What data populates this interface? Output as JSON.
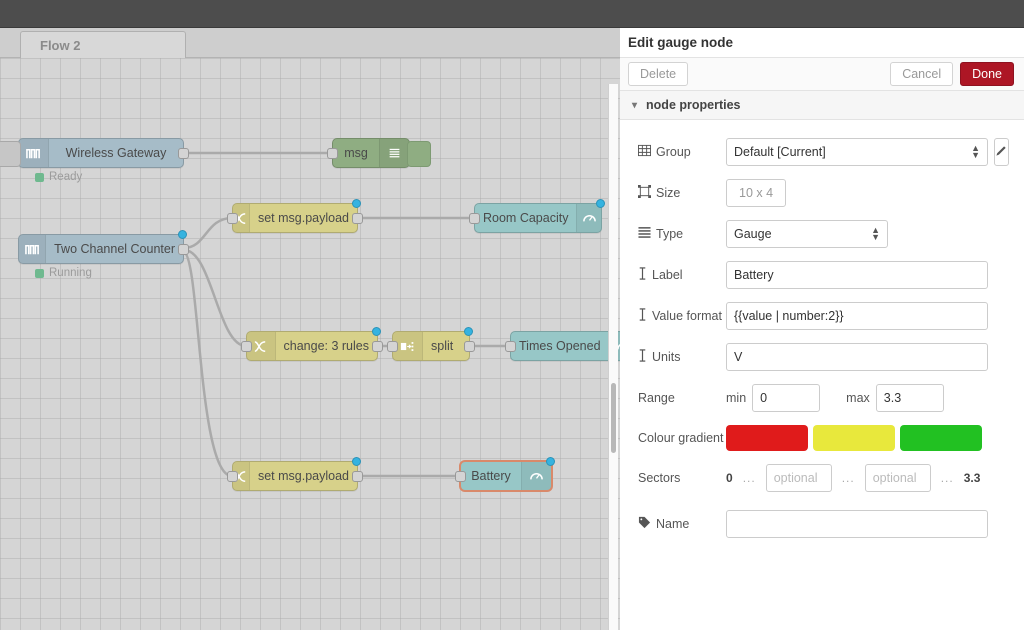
{
  "window": {
    "topbar_title": ""
  },
  "editor": {
    "tab": {
      "label": "Flow 2"
    },
    "nodes": [
      {
        "id": "wireless-gateway",
        "label": "Wireless Gateway",
        "status": "Ready",
        "type": "link",
        "color": "blue",
        "icon": "pulse-icon",
        "dirty": false,
        "selected": false
      },
      {
        "id": "two-channel-counter",
        "label": "Two Channel Counter",
        "status": "Running",
        "type": "link",
        "color": "blue",
        "icon": "pulse-icon",
        "dirty": true,
        "selected": false
      },
      {
        "id": "msg-debug",
        "label": "msg",
        "status": "",
        "type": "debug",
        "color": "green",
        "icon": "debug-lines-icon",
        "dirty": false,
        "selected": false
      },
      {
        "id": "set-msg-payload-1",
        "label": "set msg.payload",
        "status": "",
        "type": "change",
        "color": "yellow",
        "icon": "change-icon",
        "dirty": true,
        "selected": false
      },
      {
        "id": "room-capacity",
        "label": "Room Capacity",
        "status": "",
        "type": "gauge",
        "color": "teal",
        "icon": "gauge-icon",
        "dirty": true,
        "selected": false
      },
      {
        "id": "change-3-rules",
        "label": "change: 3 rules",
        "status": "",
        "type": "change",
        "color": "yellow",
        "icon": "change-icon",
        "dirty": true,
        "selected": false
      },
      {
        "id": "split",
        "label": "split",
        "status": "",
        "type": "split",
        "color": "yellow",
        "icon": "split-icon",
        "dirty": true,
        "selected": false
      },
      {
        "id": "times-opened",
        "label": "Times Opened",
        "status": "",
        "type": "gauge",
        "color": "teal",
        "icon": "gauge-icon",
        "dirty": false,
        "selected": false
      },
      {
        "id": "set-msg-payload-2",
        "label": "set msg.payload",
        "status": "",
        "type": "change",
        "color": "yellow",
        "icon": "change-icon",
        "dirty": true,
        "selected": false
      },
      {
        "id": "battery",
        "label": "Battery",
        "status": "",
        "type": "gauge",
        "color": "teal",
        "icon": "gauge-icon",
        "dirty": true,
        "selected": true
      }
    ]
  },
  "panel": {
    "title": "Edit gauge node",
    "actions": {
      "delete_label": "Delete",
      "cancel_label": "Cancel",
      "done_label": "Done",
      "done_color": "#ad1625"
    },
    "section": {
      "label": "node properties",
      "chevron": "⌄"
    },
    "fields": {
      "group": {
        "label": "Group",
        "icon": "table-icon",
        "value": "Default [Current]",
        "edit_button": "pencil-icon"
      },
      "size": {
        "label": "Size",
        "icon": "resize-icon",
        "value": "10 x 4"
      },
      "type": {
        "label": "Type",
        "icon": "list-icon",
        "value": "Gauge"
      },
      "label": {
        "label": "Label",
        "icon": "text-cursor-icon",
        "value": "Battery",
        "placeholder": ""
      },
      "value_format": {
        "label": "Value format",
        "icon": "text-cursor-icon",
        "value": "{{value | number:2}}",
        "placeholder": ""
      },
      "units": {
        "label": "Units",
        "icon": "text-cursor-icon",
        "value": "V",
        "placeholder": ""
      },
      "range": {
        "label": "Range",
        "min_label": "min",
        "min_value": "0",
        "max_label": "max",
        "max_value": "3.3"
      },
      "colour_gradient": {
        "label": "Colour gradient",
        "swatches": [
          "#e01b1b",
          "#e8e83c",
          "#22c122"
        ]
      },
      "sectors": {
        "label": "Sectors",
        "start": "0",
        "end": "3.3",
        "separator": "...",
        "optional_placeholder": "optional",
        "values": [
          "",
          ""
        ]
      },
      "name": {
        "label": "Name",
        "icon": "tag-icon",
        "value": "",
        "placeholder": ""
      }
    }
  }
}
